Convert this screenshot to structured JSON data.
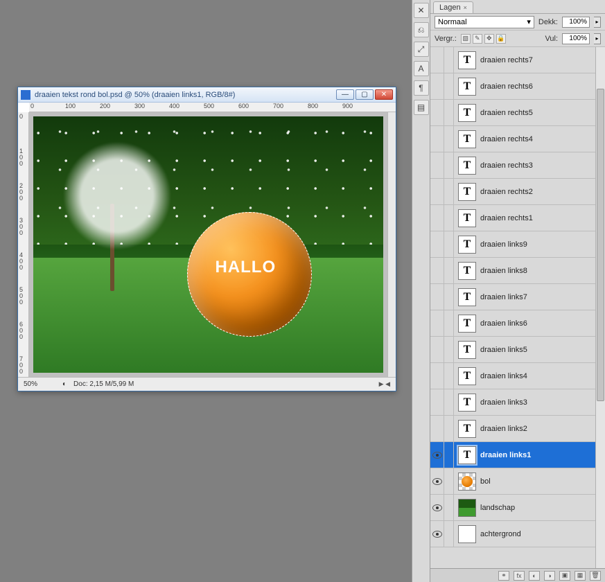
{
  "document": {
    "title": "draaien tekst rond bol.psd @ 50% (draaien links1, RGB/8#)",
    "zoom": "50%",
    "docsize": "Doc: 2,15 M/5,99 M",
    "ball_text": "HALLO",
    "ruler_h": [
      "0",
      "100",
      "200",
      "300",
      "400",
      "500",
      "600",
      "700",
      "800",
      "900"
    ],
    "ruler_v": [
      "0",
      "100",
      "200",
      "300",
      "400",
      "500",
      "600",
      "700"
    ]
  },
  "panel": {
    "tab": "Lagen",
    "blend_mode": "Normaal",
    "opacity_label": "Dekk:",
    "opacity_value": "100%",
    "lock_label": "Vergr.:",
    "fill_label": "Vul:",
    "fill_value": "100%"
  },
  "layers": [
    {
      "name": "draaien rechts7",
      "type": "T",
      "visible": false,
      "selected": false
    },
    {
      "name": "draaien rechts6",
      "type": "T",
      "visible": false,
      "selected": false
    },
    {
      "name": "draaien rechts5",
      "type": "T",
      "visible": false,
      "selected": false
    },
    {
      "name": "draaien rechts4",
      "type": "T",
      "visible": false,
      "selected": false
    },
    {
      "name": "draaien rechts3",
      "type": "T",
      "visible": false,
      "selected": false
    },
    {
      "name": "draaien rechts2",
      "type": "T",
      "visible": false,
      "selected": false
    },
    {
      "name": "draaien rechts1",
      "type": "T",
      "visible": false,
      "selected": false
    },
    {
      "name": "draaien links9",
      "type": "T",
      "visible": false,
      "selected": false
    },
    {
      "name": "draaien links8",
      "type": "T",
      "visible": false,
      "selected": false
    },
    {
      "name": "draaien links7",
      "type": "T",
      "visible": false,
      "selected": false
    },
    {
      "name": "draaien links6",
      "type": "T",
      "visible": false,
      "selected": false
    },
    {
      "name": "draaien links5",
      "type": "T",
      "visible": false,
      "selected": false
    },
    {
      "name": "draaien links4",
      "type": "T",
      "visible": false,
      "selected": false
    },
    {
      "name": "draaien links3",
      "type": "T",
      "visible": false,
      "selected": false
    },
    {
      "name": "draaien links2",
      "type": "T",
      "visible": false,
      "selected": false
    },
    {
      "name": "draaien links1",
      "type": "T",
      "visible": true,
      "selected": true
    },
    {
      "name": "bol",
      "type": "bol",
      "visible": true,
      "selected": false
    },
    {
      "name": "landschap",
      "type": "land",
      "visible": true,
      "selected": false
    },
    {
      "name": "achtergrond",
      "type": "blank",
      "visible": true,
      "selected": false
    }
  ],
  "dock_icons": [
    "✕",
    "⎌",
    "⤢",
    "A",
    "¶",
    "▤"
  ]
}
